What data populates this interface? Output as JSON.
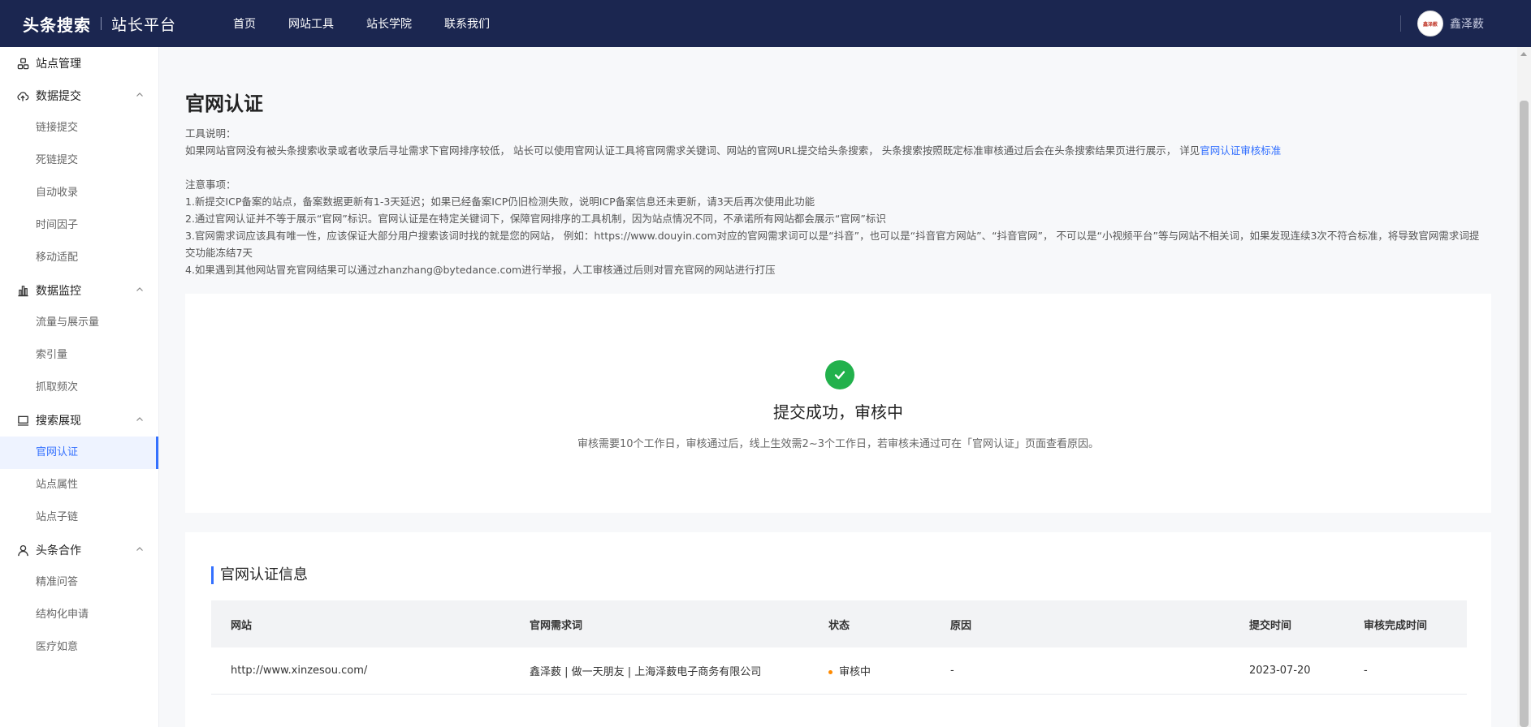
{
  "topbar": {
    "logo_main": "头条搜索",
    "logo_sub": "站长平台",
    "nav": [
      "首页",
      "网站工具",
      "站长学院",
      "联系我们"
    ],
    "avatar_text": "鑫泽薮",
    "username": "鑫泽薮"
  },
  "sidebar": {
    "groups": [
      {
        "label": "站点管理",
        "icon": "site-icon",
        "items": []
      },
      {
        "label": "数据提交",
        "icon": "cloud-upload-icon",
        "items": [
          "链接提交",
          "死链提交",
          "自动收录",
          "时间因子",
          "移动适配"
        ]
      },
      {
        "label": "数据监控",
        "icon": "bar-chart-icon",
        "items": [
          "流量与展示量",
          "索引量",
          "抓取频次"
        ]
      },
      {
        "label": "搜索展现",
        "icon": "monitor-icon",
        "items": [
          "官网认证",
          "站点属性",
          "站点子链"
        ]
      },
      {
        "label": "头条合作",
        "icon": "user-icon",
        "items": [
          "精准问答",
          "结构化申请",
          "医疗如意"
        ]
      }
    ],
    "active_item": "官网认证"
  },
  "page": {
    "title": "官网认证",
    "tool_label": "工具说明：",
    "tool_desc": "如果网站官网没有被头条搜索收录或者收录后寻址需求下官网排序较低， 站长可以使用官网认证工具将官网需求关键词、网站的官网URL提交给头条搜索， 头条搜索按照既定标准审核通过后会在头条搜索结果页进行展示， 详见",
    "tool_link": "官网认证审核标准",
    "notice_label": "注意事项：",
    "notices": [
      "1.新提交ICP备案的站点，备案数据更新有1-3天延迟；如果已经备案ICP仍旧检测失败，说明ICP备案信息还未更新，请3天后再次使用此功能",
      "2.通过官网认证并不等于展示“官网”标识。官网认证是在特定关键词下，保障官网排序的工具机制，因为站点情况不同，不承诺所有网站都会展示“官网”标识",
      "3.官网需求词应该具有唯一性，应该保证大部分用户搜索该词时找的就是您的网站， 例如：https://www.douyin.com对应的官网需求词可以是“抖音”，也可以是“抖音官方网站”、“抖音官网”， 不可以是“小视频平台”等与网站不相关词，如果发现连续3次不符合标准，将导致官网需求词提交功能冻结7天",
      "4.如果遇到其他网站冒充官网结果可以通过zhanzhang@bytedance.com进行举报，人工审核通过后则对冒充官网的网站进行打压"
    ]
  },
  "success": {
    "title": "提交成功，审核中",
    "desc": "审核需要10个工作日，审核通过后，线上生效需2~3个工作日，若审核未通过可在「官网认证」页面查看原因。"
  },
  "info": {
    "title": "官网认证信息",
    "columns": [
      "网站",
      "官网需求词",
      "状态",
      "原因",
      "提交时间",
      "审核完成时间"
    ],
    "rows": [
      {
        "site": "http://www.xinzesou.com/",
        "keyword": "鑫泽薮 | 做一天朋友 | 上海泽薮电子商务有限公司",
        "status": "审核中",
        "reason": "-",
        "submit_time": "2023-07-20",
        "complete_time": "-"
      }
    ]
  },
  "colors": {
    "topbar": "#1b2650",
    "accent": "#3370ff",
    "success": "#22b14c",
    "pending": "#ff8a00"
  }
}
